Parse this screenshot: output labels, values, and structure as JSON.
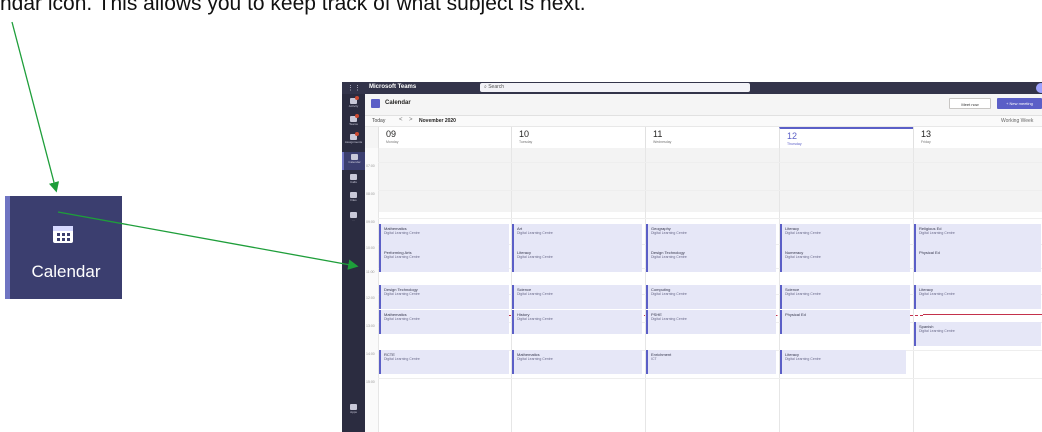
{
  "caption": "ndar icon. This allows you to keep track of what subject is next.",
  "zoom": {
    "label": "Calendar",
    "icon": "calendar-icon"
  },
  "titlebar": {
    "app_name": "Microsoft Teams",
    "search_placeholder": "Search",
    "apps_icon": "waffle-icon"
  },
  "rail": [
    {
      "label": "Activity",
      "icon": "bell-icon",
      "badge": true
    },
    {
      "label": "Teams",
      "icon": "teams-icon",
      "badge": true
    },
    {
      "label": "Assignments",
      "icon": "assignments-icon",
      "badge": true
    },
    {
      "label": "Calendar",
      "icon": "calendar-icon",
      "active": true
    },
    {
      "label": "Calls",
      "icon": "phone-icon"
    },
    {
      "label": "Files",
      "icon": "file-icon"
    },
    {
      "label": "...",
      "icon": "more-icon"
    },
    {
      "label": "Apps",
      "icon": "apps-icon"
    }
  ],
  "header": {
    "title": "Calendar",
    "meet_now": "Meet now",
    "new_meeting": "+ New meeting"
  },
  "toolbar": {
    "today": "Today",
    "prev": "<",
    "next": ">",
    "month": "November 2020",
    "view": "Working Week"
  },
  "days": [
    {
      "num": "09",
      "name": "Monday"
    },
    {
      "num": "10",
      "name": "Tuesday"
    },
    {
      "num": "11",
      "name": "Wednesday"
    },
    {
      "num": "12",
      "name": "Thursday"
    },
    {
      "num": "13",
      "name": "Friday"
    }
  ],
  "times": [
    "07:00",
    "08:00",
    "09:00",
    "10:00",
    "11:00",
    "12:00",
    "13:00",
    "14:00",
    "15:00"
  ],
  "events": [
    {
      "day": 0,
      "slot": 0,
      "title": "Mathematics",
      "loc": "Digital Learning Centre"
    },
    {
      "day": 0,
      "slot": 1,
      "title": "Performing Arts",
      "loc": "Digital Learning Centre"
    },
    {
      "day": 0,
      "slot": 2,
      "title": "Design Technology",
      "loc": "Digital Learning Centre"
    },
    {
      "day": 0,
      "slot": 3,
      "title": "Mathematics",
      "loc": "Digital Learning Centre"
    },
    {
      "day": 0,
      "slot": 4,
      "title": "RCTE",
      "loc": "Digital Learning Centre"
    },
    {
      "day": 1,
      "slot": 0,
      "title": "Art",
      "loc": "Digital Learning Centre"
    },
    {
      "day": 1,
      "slot": 1,
      "title": "Literacy",
      "loc": "Digital Learning Centre"
    },
    {
      "day": 1,
      "slot": 2,
      "title": "Science",
      "loc": "Digital Learning Centre"
    },
    {
      "day": 1,
      "slot": 3,
      "title": "History",
      "loc": "Digital Learning Centre"
    },
    {
      "day": 1,
      "slot": 4,
      "title": "Mathematics",
      "loc": "Digital Learning Centre"
    },
    {
      "day": 2,
      "slot": 0,
      "title": "Geography",
      "loc": "Digital Learning Centre"
    },
    {
      "day": 2,
      "slot": 1,
      "title": "Design Technology",
      "loc": "Digital Learning Centre"
    },
    {
      "day": 2,
      "slot": 2,
      "title": "Computing",
      "loc": "Digital Learning Centre"
    },
    {
      "day": 2,
      "slot": 3,
      "title": "PSHE",
      "loc": "Digital Learning Centre"
    },
    {
      "day": 2,
      "slot": 4,
      "title": "Enrichment",
      "loc": "ICT"
    },
    {
      "day": 3,
      "slot": 0,
      "title": "Literacy",
      "loc": "Digital Learning Centre"
    },
    {
      "day": 3,
      "slot": 1,
      "title": "Numeracy",
      "loc": "Digital Learning Centre"
    },
    {
      "day": 3,
      "slot": 2,
      "title": "Science",
      "loc": "Digital Learning Centre"
    },
    {
      "day": 3,
      "slot": 3,
      "title": "Physical Ed",
      "loc": ""
    },
    {
      "day": 3,
      "slot": 4,
      "title": "Literacy",
      "loc": "Digital Learning Centre"
    },
    {
      "day": 4,
      "slot": 0,
      "title": "Religious Ed",
      "loc": "Digital Learning Centre"
    },
    {
      "day": 4,
      "slot": 1,
      "title": "Physical Ed",
      "loc": ""
    },
    {
      "day": 4,
      "slot": 2,
      "title": "Literacy",
      "loc": "Digital Learning Centre"
    },
    {
      "day": 4,
      "slot": 3,
      "title": "Spanish",
      "loc": "Digital Learning Centre"
    }
  ]
}
